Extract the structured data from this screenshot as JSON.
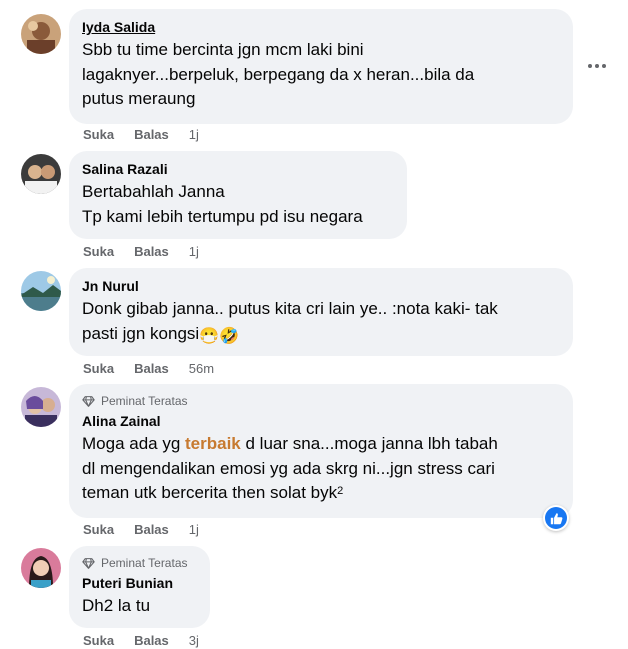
{
  "colors": {
    "bubble_bg": "#f0f2f5",
    "secondary_text": "#65676b",
    "highlight": "#c77a30",
    "like_blue": "#1877f2"
  },
  "comments": [
    {
      "name": "Iyda Salida",
      "lines": [
        "Sbb tu time bercinta jgn mcm laki bini",
        "lagaknyer...berpeluk, berpegang da x heran...bila da",
        "putus meraung"
      ],
      "like": "Suka",
      "reply": "Balas",
      "time": "1j"
    },
    {
      "name": "Salina Razali",
      "lines": [
        "Bertabahlah Janna",
        "Tp kami lebih tertumpu pd isu negara"
      ],
      "like": "Suka",
      "reply": "Balas",
      "time": "1j"
    },
    {
      "name": "Jn Nurul",
      "line1": "Donk gibab janna.. putus kita cri lain ye.. :nota kaki- tak",
      "line2": "pasti jgn kongsi",
      "emojis": "😷🤣",
      "like": "Suka",
      "reply": "Balas",
      "time": "56m"
    },
    {
      "badge": "Peminat Teratas",
      "name": "Alina Zainal",
      "line1_pre": "Moga ada yg ",
      "line1_hl": "terbaik",
      "line1_post": " d luar sna...moga janna lbh tabah",
      "line2": "dl mengendalikan emosi yg ada skrg ni...jgn stress cari",
      "line3": "teman utk bercerita then solat byk",
      "line3_sup": "2",
      "like": "Suka",
      "reply": "Balas",
      "time": "1j"
    },
    {
      "badge": "Peminat Teratas",
      "name": "Puteri Bunian",
      "lines": [
        "Dh2 la tu"
      ],
      "like": "Suka",
      "reply": "Balas",
      "time": "3j"
    }
  ],
  "icons": {
    "more": "more-horizontal-icon",
    "reaction": "thumbs-up-icon",
    "badge": "diamond-icon"
  }
}
